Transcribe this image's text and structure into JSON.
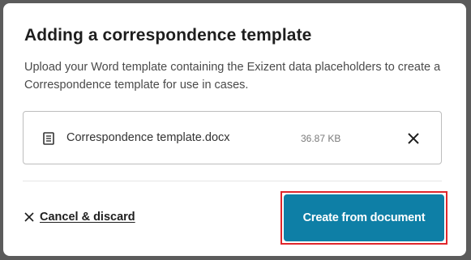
{
  "dialog": {
    "title": "Adding a correspondence template",
    "description": "Upload your Word template containing the Exizent data placeholders to create a Correspondence template for use in cases."
  },
  "file": {
    "icon": "document-icon",
    "name": "Correspondence template.docx",
    "size": "36.87 KB",
    "remove_icon": "close-icon"
  },
  "footer": {
    "cancel_icon": "close-icon",
    "cancel_label": "Cancel & discard",
    "primary_label": "Create from document"
  },
  "colors": {
    "primary": "#0e7fa6",
    "highlight": "#e0262b"
  }
}
